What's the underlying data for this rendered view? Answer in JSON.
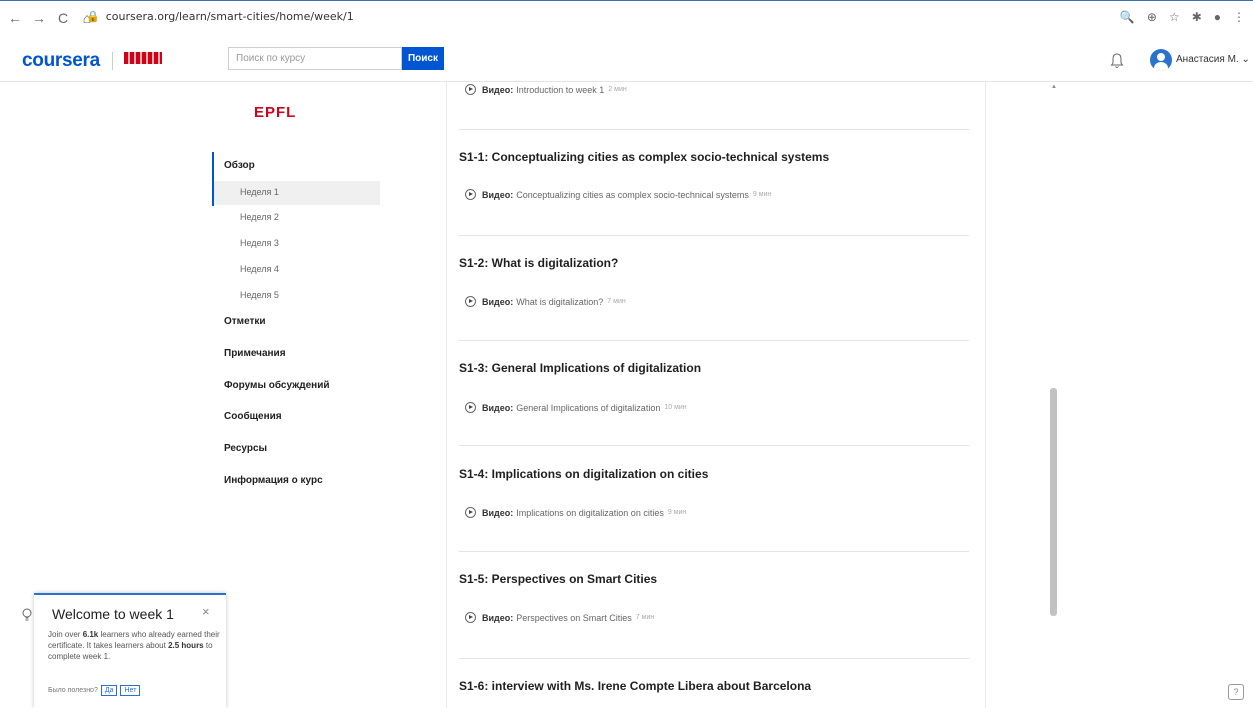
{
  "browser": {
    "url": "coursera.org/learn/smart-cities/home/week/1",
    "back": "←",
    "forward": "→",
    "reload": "C",
    "home": "⌂",
    "tools": [
      "🔍",
      "⊕",
      "☆",
      "✱",
      "●",
      "⋮"
    ]
  },
  "header": {
    "logo": "coursera",
    "search_placeholder": "Поиск по курсу",
    "search_button": "Поиск",
    "user_name": "Анастасия М.",
    "chevron": "⌄"
  },
  "sidebar": {
    "partner_logo": "EPFL",
    "overview": "Обзор",
    "weeks": [
      "Неделя 1",
      "Неделя 2",
      "Неделя 3",
      "Неделя 4",
      "Неделя 5"
    ],
    "items": [
      "Отметки",
      "Примечания",
      "Форумы обсуждений",
      "Сообщения",
      "Ресурсы",
      "Информация о курс"
    ]
  },
  "main": {
    "video_label": "Видео:",
    "top_video": {
      "title": "Introduction to week 1",
      "duration": "2 мин"
    },
    "lessons": [
      {
        "title": "S1-1: Conceptualizing cities as complex socio-technical systems",
        "video": "Conceptualizing cities as complex socio-technical systems",
        "duration": "9 мин"
      },
      {
        "title": "S1-2: What is digitalization?",
        "video": "What is digitalization?",
        "duration": "7 мин"
      },
      {
        "title": "S1-3: General Implications of digitalization",
        "video": "General Implications of digitalization",
        "duration": "10 мин"
      },
      {
        "title": "S1-4: Implications on digitalization on cities",
        "video": "Implications on digitalization on cities",
        "duration": "9 мин"
      },
      {
        "title": "S1-5: Perspectives on Smart Cities",
        "video": "Perspectives on Smart Cities",
        "duration": "7 мин"
      },
      {
        "title": "S1-6: interview with Ms. Irene Compte Libera about Barcelona"
      }
    ]
  },
  "welcome": {
    "title": "Welcome to week 1",
    "close": "×",
    "text_1": "Join over ",
    "learners": "6.1k",
    "text_2": " learners who already earned their certificate. It takes learners about ",
    "hours": "2.5 hours",
    "text_3": " to complete week 1.",
    "feedback_question": "Было полезно?",
    "yes": "Да",
    "no": "Нет"
  },
  "help": "?",
  "colors": {
    "brand": "#0056d2",
    "epfl": "#d0021b",
    "accent": "#2a73cc"
  }
}
